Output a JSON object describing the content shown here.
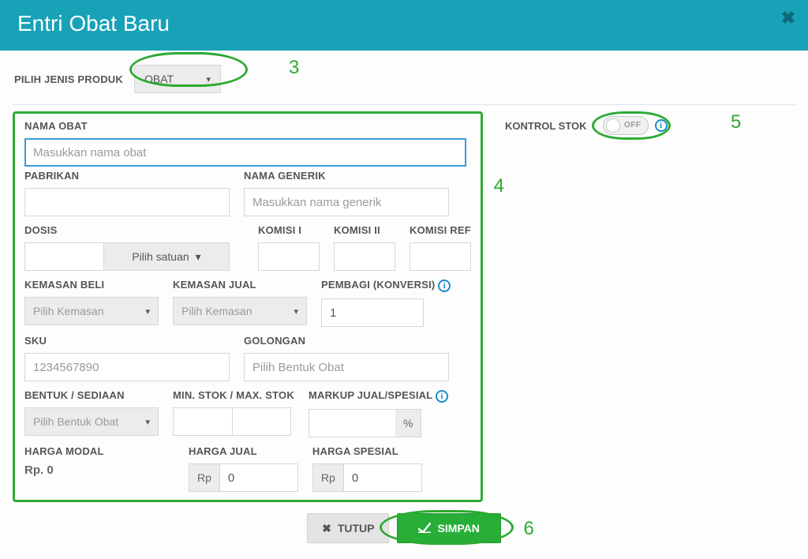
{
  "header": {
    "title": "Entri Obat Baru"
  },
  "top": {
    "label": "PILIH JENIS PRODUK",
    "product_type": "OBAT"
  },
  "annotations": {
    "n3": "3",
    "n4": "4",
    "n5": "5",
    "n6": "6"
  },
  "left": {
    "nama_obat_label": "NAMA OBAT",
    "nama_obat_placeholder": "Masukkan nama obat",
    "pabrikan_label": "PABRIKAN",
    "nama_generik_label": "NAMA GENERIK",
    "nama_generik_placeholder": "Masukkan nama generik",
    "dosis_label": "DOSIS",
    "pilih_satuan": "Pilih satuan",
    "komisi1_label": "KOMISI I",
    "komisi2_label": "KOMISI II",
    "komisiref_label": "KOMISI REF",
    "kemasan_beli_label": "KEMASAN BELI",
    "kemasan_jual_label": "KEMASAN JUAL",
    "pilih_kemasan": "Pilih Kemasan",
    "pembagi_label": "PEMBAGI (KONVERSI)",
    "pembagi_value": "1",
    "sku_label": "SKU",
    "sku_placeholder": "1234567890",
    "golongan_label": "GOLONGAN",
    "golongan_placeholder": "Pilih Bentuk Obat",
    "bentuk_label": "BENTUK / SEDIAAN",
    "bentuk_placeholder": "Pilih Bentuk Obat",
    "minmax_label": "MIN. STOK / MAX. STOK",
    "markup_label": "MARKUP JUAL/SPESIAL",
    "pct": "%",
    "harga_modal_label": "HARGA MODAL",
    "harga_modal_value": "Rp. 0",
    "harga_jual_label": "HARGA JUAL",
    "harga_spesial_label": "HARGA SPESIAL",
    "rp_prefix": "Rp",
    "zero": "0"
  },
  "right": {
    "kontrol_stok_label": "KONTROL STOK",
    "toggle_text": "OFF"
  },
  "footer": {
    "close": "TUTUP",
    "save": "SIMPAN"
  }
}
